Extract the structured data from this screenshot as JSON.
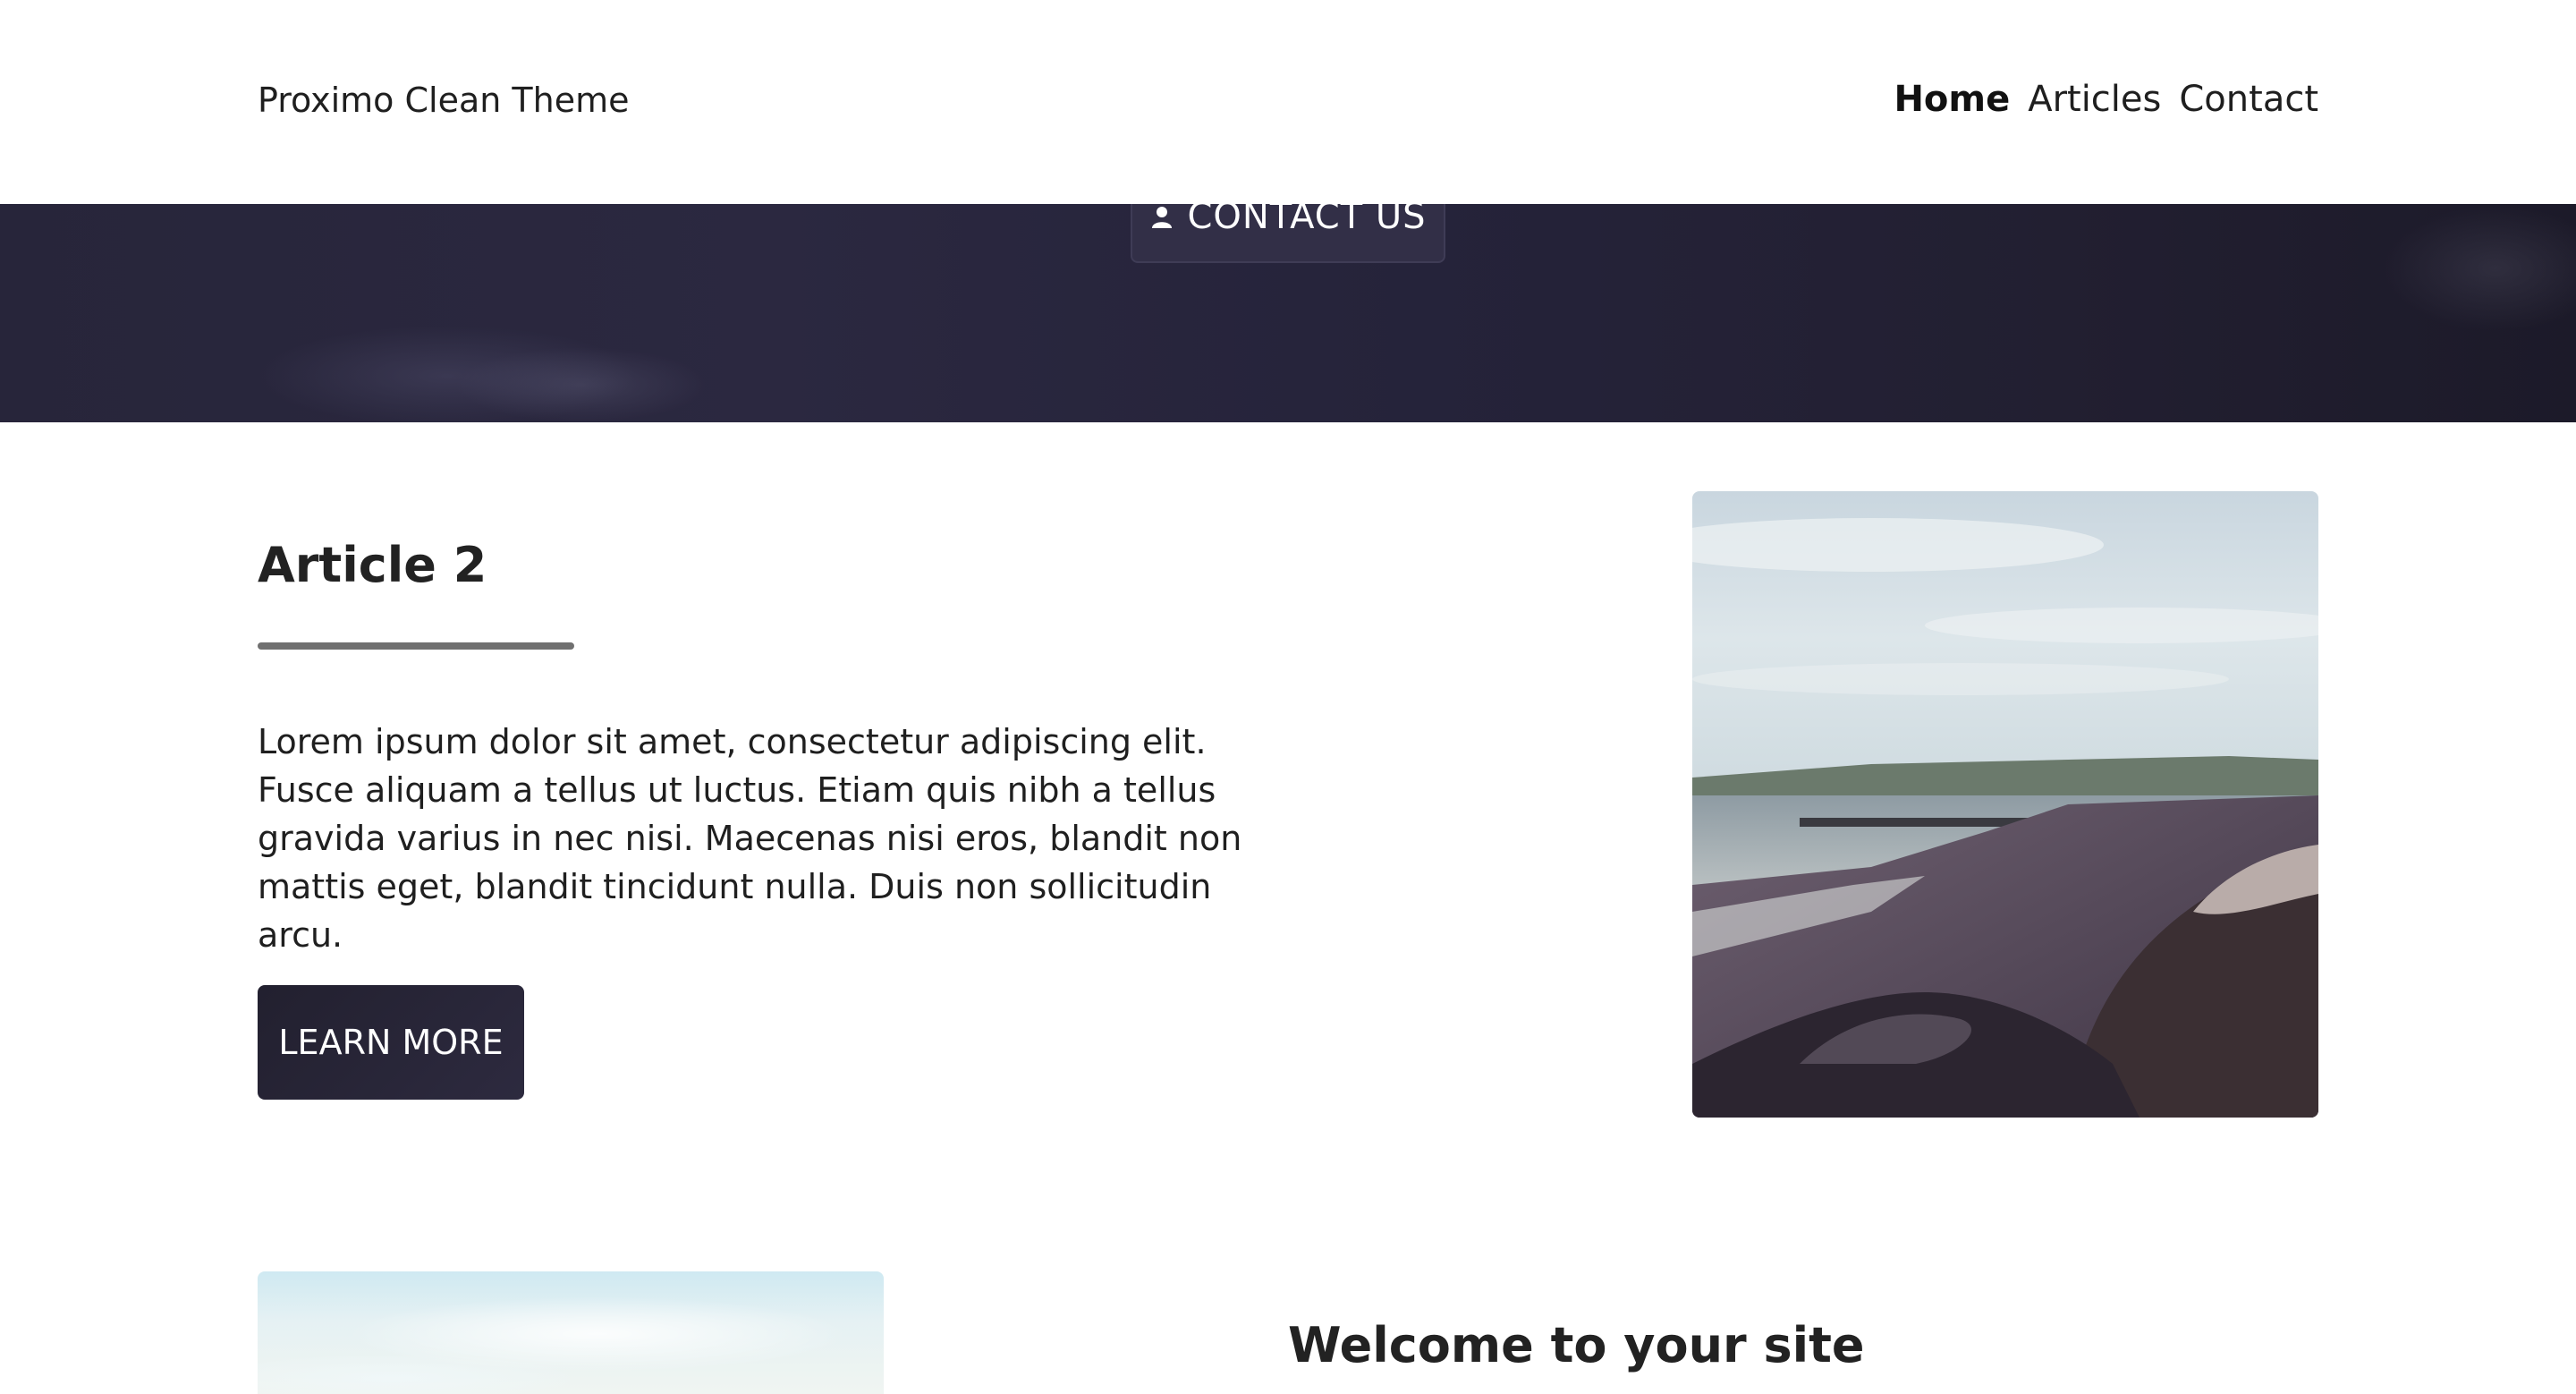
{
  "header": {
    "site_title": "Proximo Clean Theme",
    "nav": [
      {
        "label": "Home",
        "active": true
      },
      {
        "label": "Articles",
        "active": false
      },
      {
        "label": "Contact",
        "active": false
      }
    ]
  },
  "hero": {
    "button_label": "CONTACT US",
    "button_icon": "user-icon"
  },
  "article": {
    "title": "Article 2",
    "body": "Lorem ipsum dolor sit amet, consectetur adipiscing elit. Fusce aliquam a tellus ut luctus. Etiam quis nibh a tellus gravida varius in nec nisi. Maecenas nisi eros, blandit non mattis eget, blandit tincidunt nulla. Duis non sollicitudin arcu.",
    "button_label": "LEARN MORE",
    "image": "beach-photo"
  },
  "next_section": {
    "title": "Welcome to your site",
    "image": "sky-photo"
  },
  "colors": {
    "hero_bg": "#27253a",
    "button_dark": "#27253a",
    "divider": "#707070"
  }
}
